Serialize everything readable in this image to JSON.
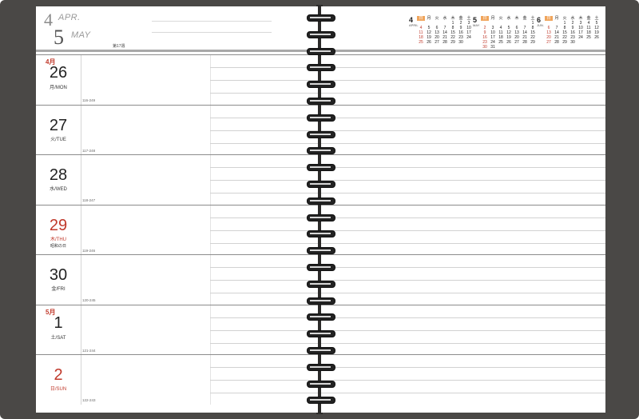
{
  "header": {
    "month_a_num": "4",
    "month_a_name": "APR.",
    "month_b_num": "5",
    "month_b_name": "MAY",
    "week": "第17週"
  },
  "days": [
    {
      "month": "4月",
      "date": "26",
      "weekday": "月/MON",
      "holiday": "",
      "count": "116-249",
      "red": false
    },
    {
      "month": "",
      "date": "27",
      "weekday": "火/TUE",
      "holiday": "",
      "count": "117-248",
      "red": false
    },
    {
      "month": "",
      "date": "28",
      "weekday": "水/WED",
      "holiday": "",
      "count": "118-247",
      "red": false
    },
    {
      "month": "",
      "date": "29",
      "weekday": "木/THU",
      "holiday": "昭和の日",
      "count": "119-246",
      "red": true
    },
    {
      "month": "",
      "date": "30",
      "weekday": "金/FRI",
      "holiday": "",
      "count": "120-245",
      "red": false
    },
    {
      "month": "5月",
      "date": "1",
      "weekday": "土/SAT",
      "holiday": "",
      "count": "121-244",
      "red": false
    },
    {
      "month": "",
      "date": "2",
      "weekday": "日/SUN",
      "holiday": "",
      "count": "122-243",
      "red": true
    }
  ],
  "mini_calendars": [
    {
      "num": "4",
      "en": "APRIL",
      "rows": [
        [
          "日",
          "月",
          "火",
          "水",
          "木",
          "金",
          "土"
        ],
        [
          "",
          "",
          "",
          "",
          "1",
          "2",
          "3"
        ],
        [
          "4",
          "5",
          "6",
          "7",
          "8",
          "9",
          "10"
        ],
        [
          "11",
          "12",
          "13",
          "14",
          "15",
          "16",
          "17"
        ],
        [
          "18",
          "19",
          "20",
          "21",
          "22",
          "23",
          "24"
        ],
        [
          "25",
          "26",
          "27",
          "28",
          "29",
          "30",
          ""
        ]
      ]
    },
    {
      "num": "5",
      "en": "MAY",
      "rows": [
        [
          "日",
          "月",
          "火",
          "水",
          "木",
          "金",
          "土"
        ],
        [
          "",
          "",
          "",
          "",
          "",
          "",
          "1"
        ],
        [
          "2",
          "3",
          "4",
          "5",
          "6",
          "7",
          "8"
        ],
        [
          "9",
          "10",
          "11",
          "12",
          "13",
          "14",
          "15"
        ],
        [
          "16",
          "17",
          "18",
          "19",
          "20",
          "21",
          "22"
        ],
        [
          "23",
          "24",
          "25",
          "26",
          "27",
          "28",
          "29"
        ],
        [
          "30",
          "31",
          "",
          "",
          "",
          "",
          ""
        ]
      ]
    },
    {
      "num": "6",
      "en": "JUN.",
      "rows": [
        [
          "日",
          "月",
          "火",
          "水",
          "木",
          "金",
          "土"
        ],
        [
          "",
          "",
          "1",
          "2",
          "3",
          "4",
          "5"
        ],
        [
          "6",
          "7",
          "8",
          "9",
          "10",
          "11",
          "12"
        ],
        [
          "13",
          "14",
          "15",
          "16",
          "17",
          "18",
          "19"
        ],
        [
          "20",
          "21",
          "22",
          "23",
          "24",
          "25",
          "26"
        ],
        [
          "27",
          "28",
          "29",
          "30",
          "",
          "",
          ""
        ]
      ]
    }
  ]
}
